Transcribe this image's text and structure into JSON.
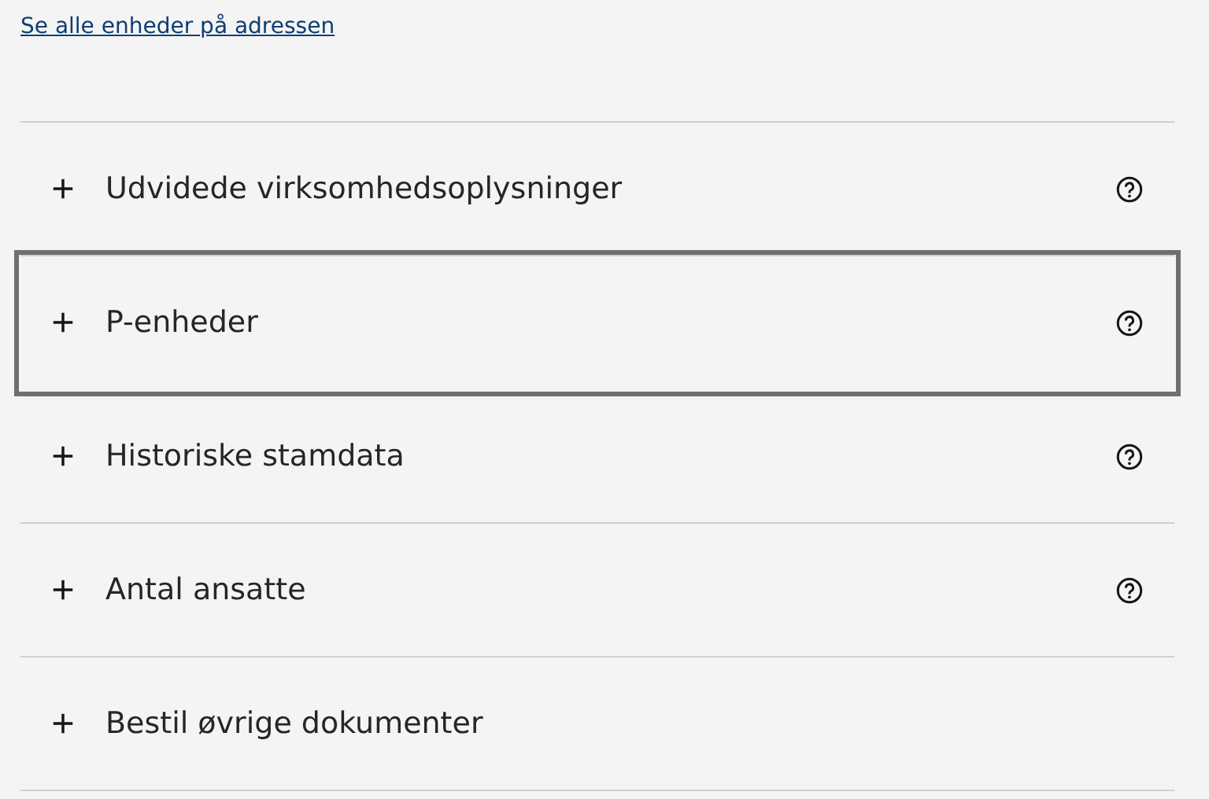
{
  "link": "Se alle enheder på adressen",
  "sections": [
    {
      "title": "Udvidede virksomhedsoplysninger",
      "expanded": false,
      "focused": false,
      "help": true
    },
    {
      "title": "P-enheder",
      "expanded": false,
      "focused": true,
      "help": true
    },
    {
      "title": "Historiske stamdata",
      "expanded": false,
      "focused": false,
      "help": true
    },
    {
      "title": "Antal ansatte",
      "expanded": false,
      "focused": false,
      "help": true
    },
    {
      "title": "Bestil øvrige dokumenter",
      "expanded": false,
      "focused": false,
      "help": false
    }
  ]
}
